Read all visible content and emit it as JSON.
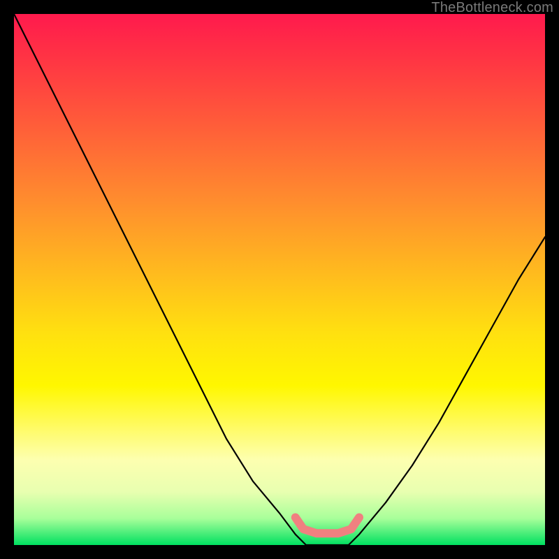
{
  "watermark": "TheBottleneck.com",
  "chart_data": {
    "type": "line",
    "title": "",
    "xlabel": "",
    "ylabel": "",
    "xlim": [
      0,
      100
    ],
    "ylim": [
      0,
      100
    ],
    "grid": false,
    "legend": false,
    "series": [
      {
        "name": "bottleneck-curve",
        "x": [
          0,
          5,
          10,
          15,
          20,
          25,
          30,
          35,
          40,
          45,
          50,
          53,
          55,
          58,
          60,
          63,
          65,
          70,
          75,
          80,
          85,
          90,
          95,
          100
        ],
        "y": [
          100,
          90,
          80,
          70,
          60,
          50,
          40,
          30,
          20,
          12,
          6,
          2,
          0,
          0,
          0,
          0,
          2,
          8,
          15,
          23,
          32,
          41,
          50,
          58
        ]
      }
    ],
    "highlight": {
      "name": "flat-bottom",
      "color": "#f08080",
      "x_range": [
        53,
        65
      ],
      "y": 0
    },
    "background_gradient": [
      {
        "pos": 0.0,
        "color": "#ff1a4d"
      },
      {
        "pos": 0.35,
        "color": "#ff8c2e"
      },
      {
        "pos": 0.7,
        "color": "#fff700"
      },
      {
        "pos": 1.0,
        "color": "#00e060"
      }
    ]
  }
}
